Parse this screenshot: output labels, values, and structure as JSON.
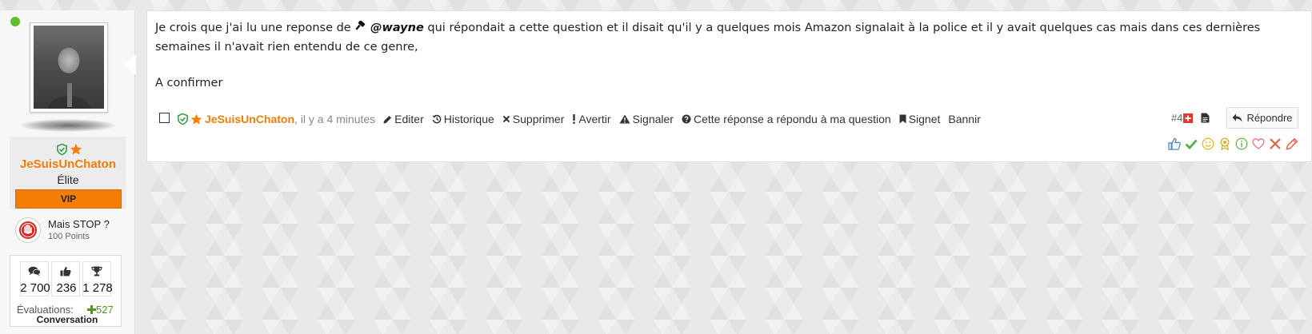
{
  "user": {
    "name": "JeSuisUnChaton",
    "rank": "Élite",
    "vip_label": "VIP",
    "trophy": {
      "title": "Mais STOP ?",
      "points": "100 Points"
    },
    "stats": {
      "messages": "2 700",
      "likes": "236",
      "trophies": "1 278"
    },
    "evaluations_label": "Évaluations:",
    "evaluations_value": "527",
    "conversation_label": "Conversation"
  },
  "post": {
    "text_before": "Je crois que j'ai lu une reponse de",
    "mention": "@wayne",
    "text_after": "qui répondait a cette question et il disait qu'il y a quelques mois Amazon signalait à la police et il y avait quelques cas mais dans ces dernières semaines il n'avait rien entendu de ce genre,",
    "text_confirm": "A confirmer",
    "author": "JeSuisUnChaton",
    "time": ", il y a 4 minutes",
    "actions": {
      "edit": "Editer",
      "history": "Historique",
      "delete": "Supprimer",
      "warn": "Avertir",
      "report": "Signaler",
      "answered": "Cette réponse a répondu à ma question",
      "bookmark": "Signet",
      "ban": "Bannir"
    },
    "number": "#4",
    "reply_label": "Répondre"
  },
  "colors": {
    "accent": "#f47d06",
    "online": "#5cc229",
    "positive": "#4c9a12"
  },
  "icons": [
    "shield-check-icon",
    "star-icon",
    "comments-icon",
    "thumbs-up-icon",
    "trophy-icon",
    "pencil-icon",
    "history-icon",
    "times-icon",
    "exclamation-icon",
    "warning-icon",
    "question-circle-icon",
    "bookmark-icon",
    "plus-square-icon",
    "file-icon",
    "reply-icon",
    "gavel-icon",
    "reaction-like-icon",
    "reaction-check-icon",
    "reaction-smile-icon",
    "reaction-award-icon",
    "reaction-info-icon",
    "reaction-heart-icon",
    "reaction-cross-icon",
    "reaction-pencil-icon"
  ]
}
